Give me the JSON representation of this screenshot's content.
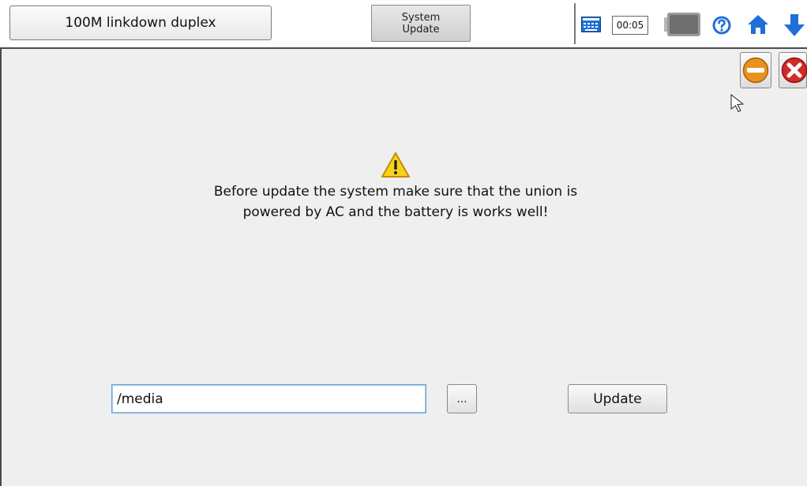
{
  "topbar": {
    "status_text": "100M linkdown duplex",
    "page_title": "System\nUpdate",
    "timer": "00:05",
    "icons": {
      "keyboard": "keyboard-icon",
      "battery": "battery-icon",
      "help": "help-icon",
      "home": "home-icon",
      "down": "arrow-down-icon"
    }
  },
  "window_controls": {
    "minimize_icon": "minimize-icon",
    "close_icon": "close-icon"
  },
  "main": {
    "warning_icon": "warning-icon",
    "message": "Before update the system make sure that the union is\npowered by AC and the battery is works well!",
    "path_value": "/media",
    "browse_label": "...",
    "update_label": "Update"
  },
  "colors": {
    "accent_blue": "#1e6fd8",
    "close_red": "#d42a2a",
    "minimize_orange": "#e8921c",
    "warning_yellow": "#f7d21a"
  }
}
